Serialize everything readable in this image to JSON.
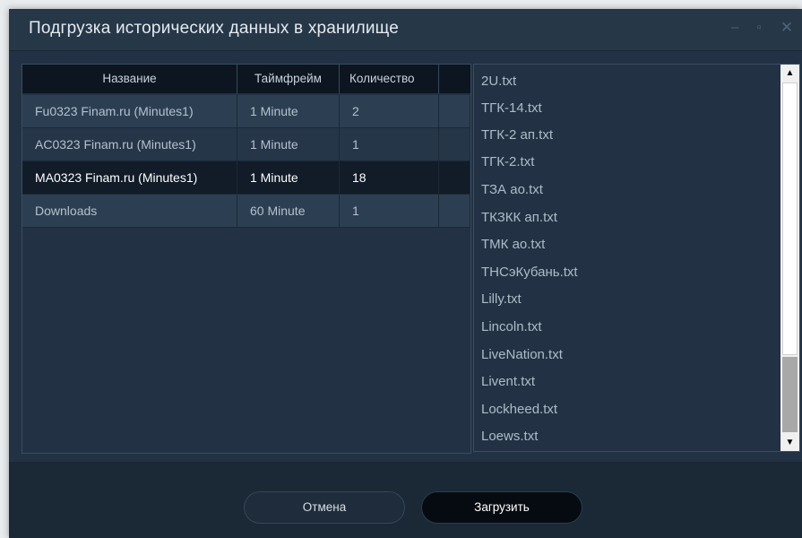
{
  "window": {
    "title": "Подгрузка исторических данных в хранилище",
    "minimize_glyph": "–",
    "maximize_glyph": "▫",
    "close_glyph": "✕"
  },
  "table": {
    "headers": [
      "Название",
      "Таймфрейм",
      "Количество"
    ],
    "rows": [
      {
        "name": "Fu0323 Finam.ru (Minutes1)",
        "timeframe": "1 Minute",
        "count": "2"
      },
      {
        "name": "AC0323 Finam.ru (Minutes1)",
        "timeframe": "1 Minute",
        "count": "1"
      },
      {
        "name": "MA0323 Finam.ru (Minutes1)",
        "timeframe": "1 Minute",
        "count": "18"
      },
      {
        "name": "Downloads",
        "timeframe": "60 Minute",
        "count": "1"
      }
    ],
    "selected_row": 2
  },
  "files": [
    "2U.txt",
    "ТГК-14.txt",
    "ТГК-2 ап.txt",
    "ТГК-2.txt",
    "ТЗА ао.txt",
    "ТКЗКК ап.txt",
    "ТМК ао.txt",
    "ТНСэКубань.txt",
    "Lilly.txt",
    "Lincoln.txt",
    "LiveNation.txt",
    "Livent.txt",
    "Lockheed.txt",
    "Loews.txt"
  ],
  "scrollbar": {
    "up_glyph": "▲",
    "down_glyph": "▼"
  },
  "buttons": {
    "cancel": "Отмена",
    "load": "Загрузить"
  },
  "colors": {
    "window_bg": "#223244",
    "header_bg": "#0c1520",
    "selected_row_bg": "#111c28",
    "footer_bg": "#1b2836"
  }
}
